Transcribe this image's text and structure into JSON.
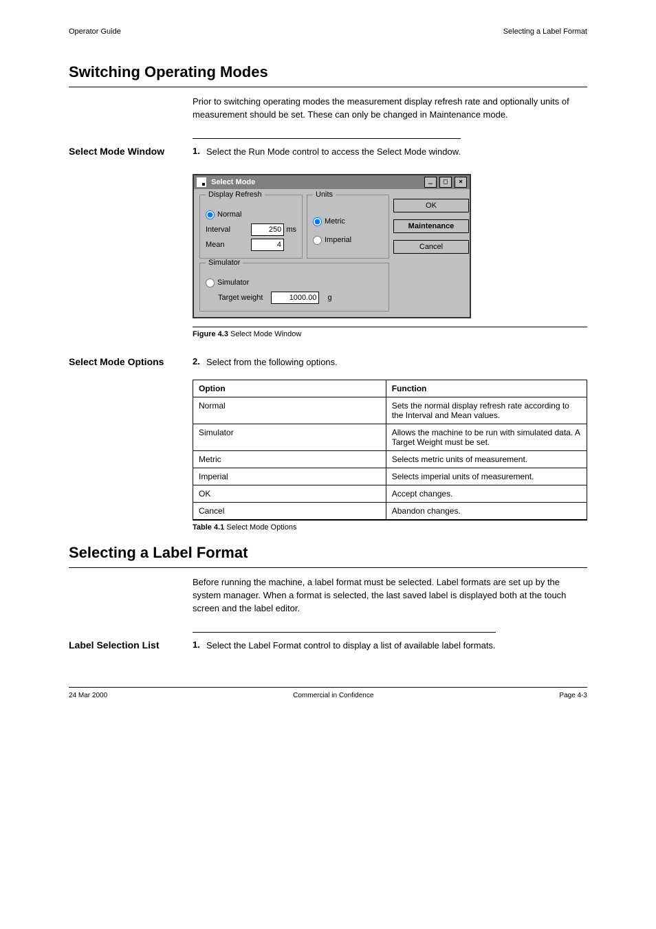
{
  "header": {
    "left": "Operator Guide",
    "right": "Selecting a Label Format"
  },
  "h_switching": "Switching Operating Modes",
  "intro": "Prior to switching operating modes the measurement display refresh rate and optionally units of measurement should be set. These can only be changed in Maintenance mode.",
  "row_select": {
    "label": "Select Mode Window",
    "num": "1.",
    "text": "Select the Run Mode control to access the Select Mode window."
  },
  "win": {
    "title": "Select Mode",
    "group_refresh": {
      "legend": "Display Refresh",
      "radio_normal": "Normal",
      "field_interval": "Interval",
      "field_interval_val": "250",
      "field_interval_unit": "ms",
      "field_mean": "Mean",
      "field_mean_val": "4"
    },
    "group_units": {
      "legend": "Units",
      "radio_metric": "Metric",
      "radio_imperial": "Imperial"
    },
    "buttons": {
      "ok": "OK",
      "mode": "Maintenance",
      "cancel": "Cancel"
    },
    "group_simulator": {
      "legend": "Simulator",
      "radio_sim": "Simulator",
      "field_target": "Target weight",
      "field_target_val": "1000.00",
      "field_target_unit": "g"
    }
  },
  "fig": {
    "num": "Figure 4.3",
    "text": "Select Mode Window"
  },
  "row_options": {
    "label": "Select Mode Options",
    "num": "2.",
    "text": "Select from the following options."
  },
  "table": {
    "head_opt": "Option",
    "head_fn": "Function",
    "rows": [
      {
        "opt": "Normal",
        "fn": "Sets the normal display refresh rate according to the Interval and Mean values."
      },
      {
        "opt": "Simulator",
        "fn": "Allows the machine to be run with simulated data. A Target Weight must be set."
      },
      {
        "opt": "Metric",
        "fn": "Selects metric units of measurement."
      },
      {
        "opt": "Imperial",
        "fn": "Selects imperial units of measurement."
      },
      {
        "opt": "OK",
        "fn": "Accept changes."
      },
      {
        "opt": "Cancel",
        "fn": "Abandon changes."
      }
    ]
  },
  "tablecap": {
    "num": "Table 4.1",
    "text": "Select Mode Options"
  },
  "h_label": "Selecting a Label Format",
  "label_intro": "Before running the machine, a label format must be selected. Label formats are set up by the system manager. When a format is selected, the last saved label is displayed both at the touch screen and the label editor.",
  "row_label": {
    "label": "Label Selection List",
    "num": "1.",
    "text": "Select the Label Format control to display a list of available label formats."
  },
  "footer": {
    "left": "24 Mar 2000",
    "center": "Commercial in Confidence",
    "right": "Page 4-3"
  }
}
